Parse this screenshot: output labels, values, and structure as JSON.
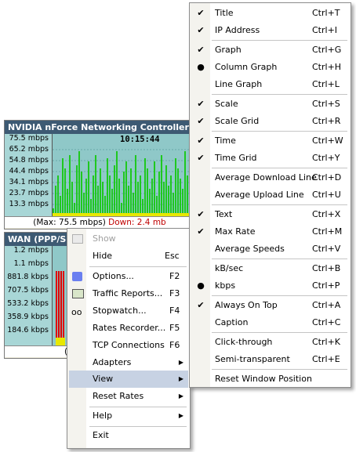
{
  "meter1": {
    "title": "NVIDIA nForce Networking Controller [10.",
    "time": "10:15:44",
    "scale": [
      "75.5 mbps",
      "65.2 mbps",
      "54.8 mbps",
      "44.4 mbps",
      "34.1 mbps",
      "23.7 mbps",
      "13.3 mbps"
    ],
    "status_max": "(Max: 75.5 mbps)",
    "status_down": "Down: 2.4 mb",
    "bars": [
      0.12,
      0.45,
      0.6,
      0.3,
      0.85,
      0.7,
      0.4,
      0.9,
      0.5,
      0.2,
      0.75,
      0.95,
      0.65,
      0.35,
      0.55,
      0.8,
      0.25,
      0.6,
      0.9,
      0.45,
      0.7,
      0.5,
      0.3,
      0.85,
      0.6,
      0.4,
      0.75,
      0.95,
      0.55,
      0.2,
      0.65,
      0.8,
      0.45,
      0.7,
      0.35,
      0.9,
      0.5,
      0.6,
      0.25,
      0.85,
      0.7,
      0.4,
      0.55,
      0.8,
      0.3,
      0.65,
      0.9,
      0.5,
      0.75,
      0.45,
      0.6,
      0.35,
      0.85,
      0.7,
      0.55,
      0.4,
      0.95,
      0.6,
      0.5,
      0.3
    ]
  },
  "meter2": {
    "title": "WAN (PPP/SLI",
    "scale": [
      "1.2 mbps",
      "1.1 mbps",
      "881.8 kbps",
      "707.5 kbps",
      "533.2 kbps",
      "358.9 kbps",
      "184.6 kbps"
    ],
    "status": "("
  },
  "context_menu": {
    "items": [
      {
        "label": "Show",
        "shortcut": "",
        "disabled": true
      },
      {
        "label": "Hide",
        "shortcut": "Esc"
      },
      {
        "label": "Options...",
        "shortcut": "F2"
      },
      {
        "label": "Traffic Reports...",
        "shortcut": "F3"
      },
      {
        "label": "Stopwatch...",
        "shortcut": "F4"
      },
      {
        "label": "Rates Recorder...",
        "shortcut": "F5"
      },
      {
        "label": "TCP Connections",
        "shortcut": "F6"
      },
      {
        "label": "Adapters",
        "shortcut": ""
      },
      {
        "label": "View",
        "shortcut": ""
      },
      {
        "label": "Reset Rates",
        "shortcut": ""
      },
      {
        "label": "Help",
        "shortcut": ""
      },
      {
        "label": "Exit",
        "shortcut": ""
      }
    ]
  },
  "view_menu": {
    "items": [
      {
        "label": "Title",
        "shortcut": "Ctrl+T",
        "mark": "✔"
      },
      {
        "label": "IP Address",
        "shortcut": "Ctrl+I",
        "mark": "✔"
      },
      {
        "label": "Graph",
        "shortcut": "Ctrl+G",
        "mark": "✔"
      },
      {
        "label": "Column Graph",
        "shortcut": "Ctrl+H",
        "mark": "●"
      },
      {
        "label": "Line Graph",
        "shortcut": "Ctrl+L",
        "mark": ""
      },
      {
        "label": "Scale",
        "shortcut": "Ctrl+S",
        "mark": "✔"
      },
      {
        "label": "Scale Grid",
        "shortcut": "Ctrl+R",
        "mark": "✔"
      },
      {
        "label": "Time",
        "shortcut": "Ctrl+W",
        "mark": "✔"
      },
      {
        "label": "Time Grid",
        "shortcut": "Ctrl+Y",
        "mark": "✔"
      },
      {
        "label": "Average Download Line",
        "shortcut": "Ctrl+D",
        "mark": ""
      },
      {
        "label": "Average Upload Line",
        "shortcut": "Ctrl+U",
        "mark": ""
      },
      {
        "label": "Text",
        "shortcut": "Ctrl+X",
        "mark": "✔"
      },
      {
        "label": "Max Rate",
        "shortcut": "Ctrl+M",
        "mark": "✔"
      },
      {
        "label": "Average Speeds",
        "shortcut": "Ctrl+V",
        "mark": ""
      },
      {
        "label": "kB/sec",
        "shortcut": "Ctrl+B",
        "mark": ""
      },
      {
        "label": "kbps",
        "shortcut": "Ctrl+P",
        "mark": "●"
      },
      {
        "label": "Always On Top",
        "shortcut": "Ctrl+A",
        "mark": "✔"
      },
      {
        "label": "Caption",
        "shortcut": "Ctrl+C",
        "mark": ""
      },
      {
        "label": "Click-through",
        "shortcut": "Ctrl+K",
        "mark": ""
      },
      {
        "label": "Semi-transparent",
        "shortcut": "Ctrl+E",
        "mark": ""
      },
      {
        "label": "Reset Window Position",
        "shortcut": "",
        "mark": ""
      }
    ]
  }
}
